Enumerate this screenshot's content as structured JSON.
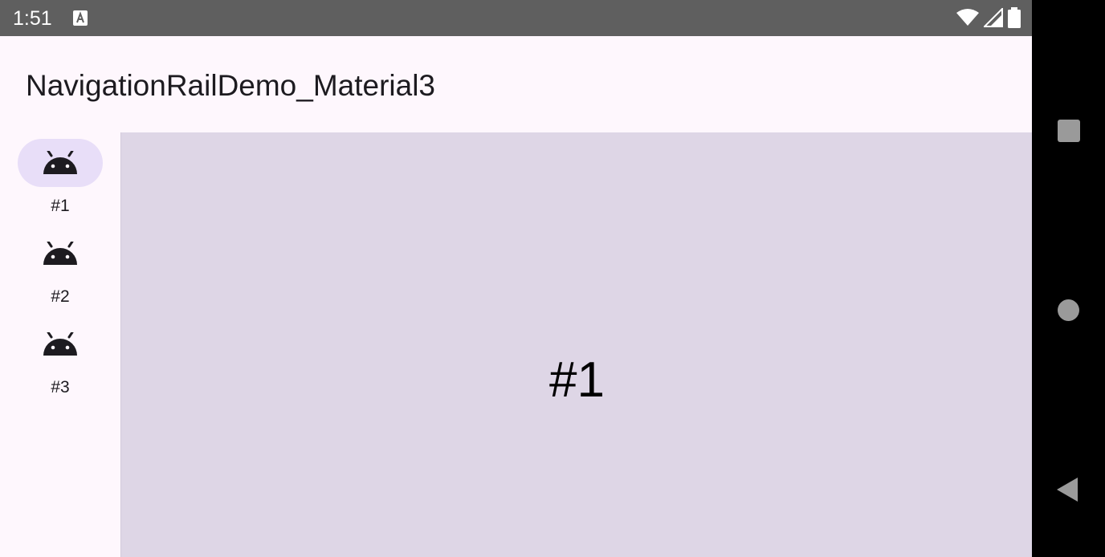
{
  "status_bar": {
    "time": "1:51",
    "icons": [
      "accessibility-a-icon",
      "wifi-icon",
      "cellular-signal-icon",
      "battery-icon"
    ]
  },
  "app_bar": {
    "title": "NavigationRailDemo_Material3"
  },
  "rail": {
    "items": [
      {
        "label": "#1",
        "icon": "android-icon",
        "selected": true
      },
      {
        "label": "#2",
        "icon": "android-icon",
        "selected": false
      },
      {
        "label": "#3",
        "icon": "android-icon",
        "selected": false
      }
    ]
  },
  "content": {
    "text": "#1"
  },
  "nav_bar": {
    "buttons": [
      "recents-square-icon",
      "home-circle-icon",
      "back-triangle-icon"
    ]
  },
  "colors": {
    "status_bar_bg": "#5f5f5f",
    "surface": "#fef7fd",
    "selected_indicator": "#e8def8",
    "content_bg": "#ded6e6",
    "nav_bar_bg": "#000000",
    "on_surface": "#1d1b20"
  }
}
